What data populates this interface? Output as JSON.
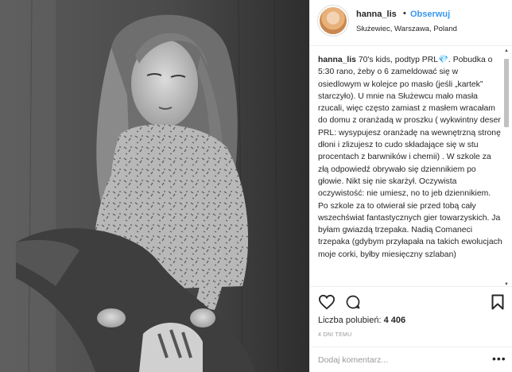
{
  "post": {
    "photo_alt": "Black and white photo of a girl with long hair in a patterned sweater and jeans",
    "header": {
      "username": "hanna_lis",
      "separator": "•",
      "follow_label": "Obserwuj",
      "location": "Służewiec, Warszawa, Poland"
    },
    "caption": {
      "username": "hanna_lis",
      "text": " 70's kids, podtyp PRL💎. Pobudka o 5:30 rano, żeby o 6 zameldować się w osiedlowym w kolejce po masło (jeśli „kartek” starczyło). U mnie na Służewcu mało masła rzucali, więc często zamiast z masłem wracałam do domu z oranżadą w proszku ( wykwintny deser PRL: wysypujesz oranżadę na wewnętrzną stronę dłoni i zlizujesz to cudo składające się w stu procentach z barwników i chemii) . W szkole za złą odpowiedź obrywało się dziennikiem po głowie. Nikt się nie skarżył. Oczywista oczywistość: nie umiesz, no to jeb dziennikiem. Po szkole za to otwierał sie przed tobą cały wszechświat fantastycznych gier towarzyskich. Ja byłam gwiazdą trzepaka. Nadią Comaneci trzepaka (gdybym przyłapała na takich ewolucjach moje corki, byłby miesięczny szlaban)"
    },
    "actions": {
      "like_icon": "heart-icon",
      "comment_icon": "comment-icon",
      "save_icon": "bookmark-icon"
    },
    "likes": {
      "label": "Liczba polubień:",
      "count": "4 406"
    },
    "time_ago": "4 DNI TEMU",
    "comment": {
      "placeholder": "Dodaj komentarz...",
      "more_label": "•••"
    }
  }
}
